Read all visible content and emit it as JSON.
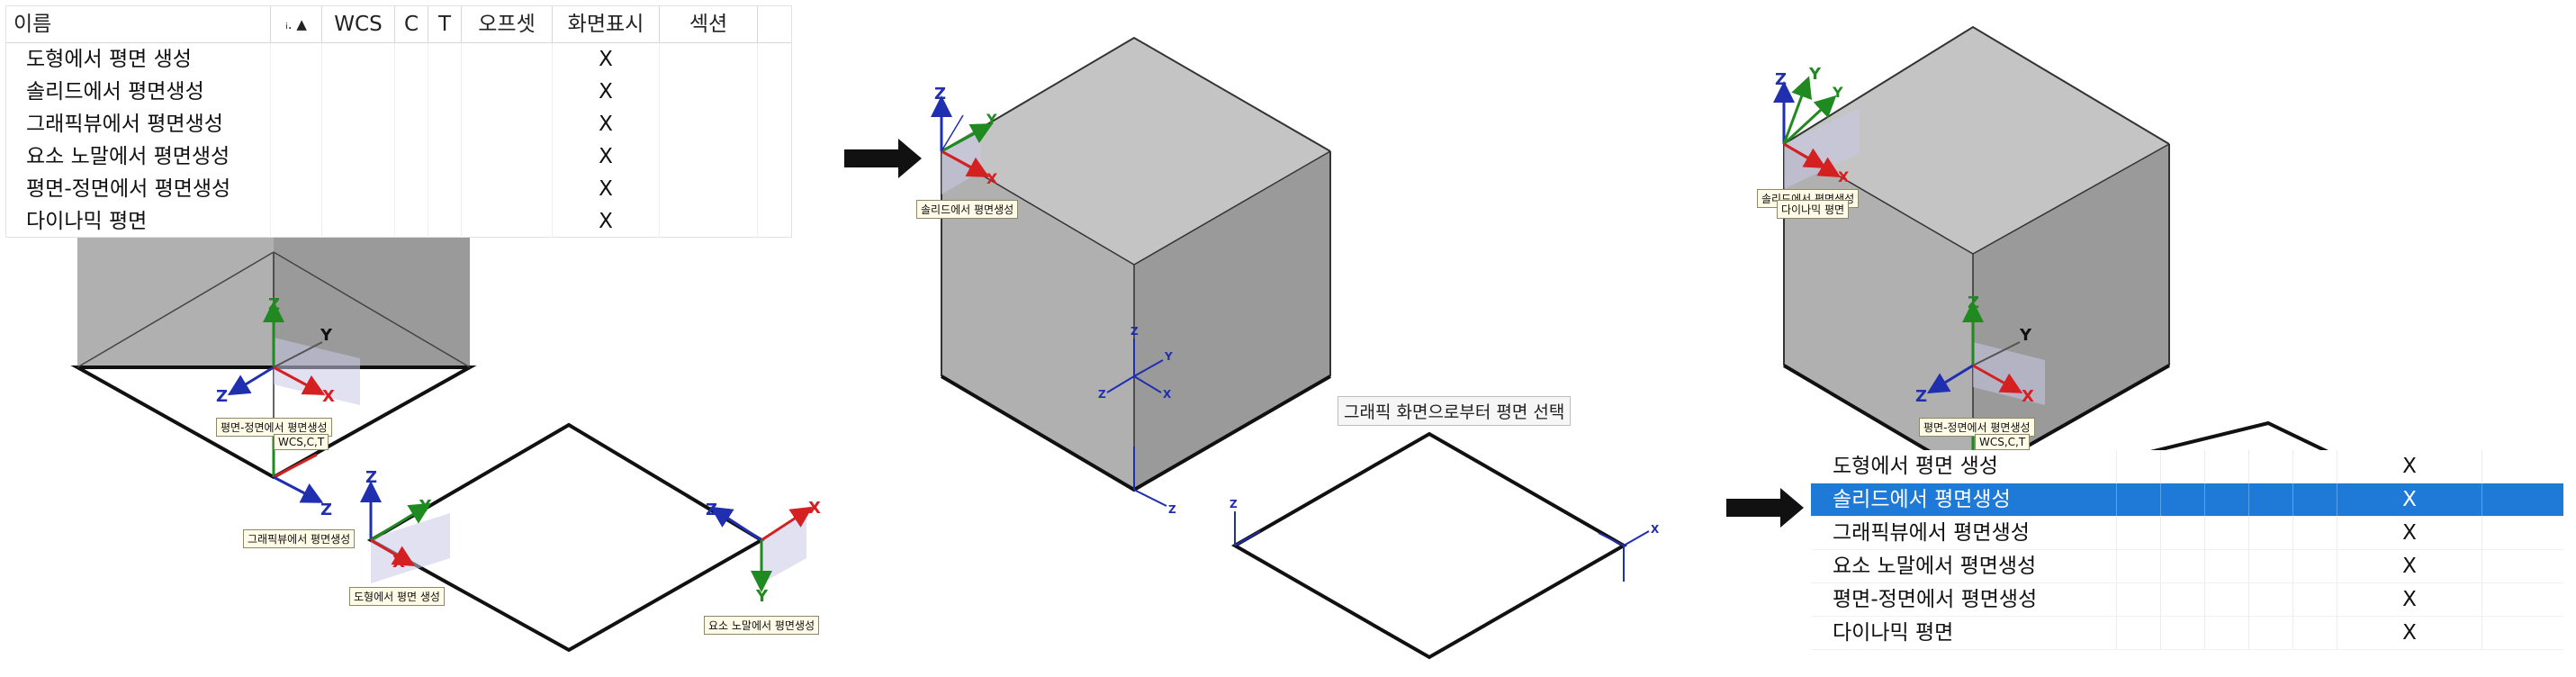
{
  "left_list": {
    "headers": [
      "이름",
      "ᵢ. ▲",
      "WCS",
      "C",
      "T",
      "오프셋",
      "화면표시",
      "섹션",
      ""
    ],
    "rows": [
      {
        "name": "도형에서 평면 생성",
        "display": "X"
      },
      {
        "name": "솔리드에서 평면생성",
        "display": "X"
      },
      {
        "name": "그래픽뷰에서 평면생성",
        "display": "X"
      },
      {
        "name": "요소 노말에서 평면생성",
        "display": "X"
      },
      {
        "name": "평면-정면에서 평면생성",
        "display": "X"
      },
      {
        "name": "다이나믹 평면",
        "display": "X"
      }
    ]
  },
  "left_view": {
    "tag_front": "평면-정면에서 평면생성",
    "tag_wcs": "WCS,C,T",
    "tag_graphic": "그래픽뷰에서 평면생성",
    "tag_shape": "도형에서 평면 생성",
    "tag_normal": "요소 노말에서 평면생성"
  },
  "middle_view": {
    "tag_solid": "솔리드에서 평면생성",
    "hint": "그래픽 화면으로부터 평면 선택"
  },
  "right_view": {
    "tag_solid": "솔리드에서 평면생성",
    "tag_dynamic": "다이나믹 평면",
    "tag_front": "평면-정면에서 평면생성",
    "tag_wcs": "WCS,C,T"
  },
  "right_list": {
    "selected_index": 1,
    "rows": [
      {
        "name": "도형에서 평면 생성",
        "display": "X"
      },
      {
        "name": "솔리드에서 평면생성",
        "display": "X"
      },
      {
        "name": "그래픽뷰에서 평면생성",
        "display": "X"
      },
      {
        "name": "요소 노말에서 평면생성",
        "display": "X"
      },
      {
        "name": "평면-정면에서 평면생성",
        "display": "X"
      },
      {
        "name": "다이나믹 평면",
        "display": "X"
      }
    ]
  },
  "axis_labels": {
    "x": "X",
    "y": "Y",
    "z": "Z"
  },
  "colors": {
    "x_axis": "#d42020",
    "y_axis": "#1f8a1f",
    "z_axis": "#1f2fb0",
    "cube_top": "#c4c4c4",
    "cube_left": "#b0b0b0",
    "cube_right": "#9a9a9a",
    "selection": "#1e7ad6"
  }
}
